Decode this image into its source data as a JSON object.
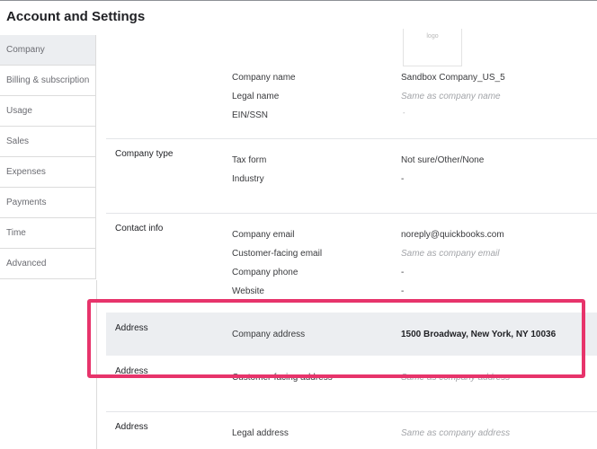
{
  "header": {
    "title": "Account and Settings"
  },
  "sidebar": {
    "items": [
      {
        "label": "Company",
        "active": true
      },
      {
        "label": "Billing & subscription"
      },
      {
        "label": "Usage"
      },
      {
        "label": "Sales"
      },
      {
        "label": "Expenses"
      },
      {
        "label": "Payments"
      },
      {
        "label": "Time"
      },
      {
        "label": "Advanced"
      }
    ]
  },
  "logo": {
    "placeholder": "logo"
  },
  "company_name": {
    "fields": [
      {
        "label": "Company name",
        "value": "Sandbox Company_US_5"
      },
      {
        "label": "Legal name",
        "value": "Same as company name"
      },
      {
        "label": "EIN/SSN",
        "value": "-"
      }
    ]
  },
  "company_type": {
    "section": "Company type",
    "fields": [
      {
        "label": "Tax form",
        "value": "Not sure/Other/None"
      },
      {
        "label": "Industry",
        "value": "-"
      }
    ]
  },
  "contact_info": {
    "section": "Contact info",
    "fields": [
      {
        "label": "Company email",
        "value": "noreply@quickbooks.com"
      },
      {
        "label": "Customer-facing email",
        "value": "Same as company email"
      },
      {
        "label": "Company phone",
        "value": "-"
      },
      {
        "label": "Website",
        "value": "-"
      }
    ]
  },
  "address": {
    "company": {
      "section": "Address",
      "label": "Company address",
      "value": "1500 Broadway, New York, NY 10036"
    },
    "customer": {
      "section": "Address",
      "label": "Customer-facing address",
      "value": "Same as company address"
    },
    "legal": {
      "section": "Address",
      "label": "Legal address",
      "value": "Same as company address"
    }
  },
  "colors": {
    "highlight_border": "#e7346b",
    "row_highlight": "#eceef1"
  }
}
